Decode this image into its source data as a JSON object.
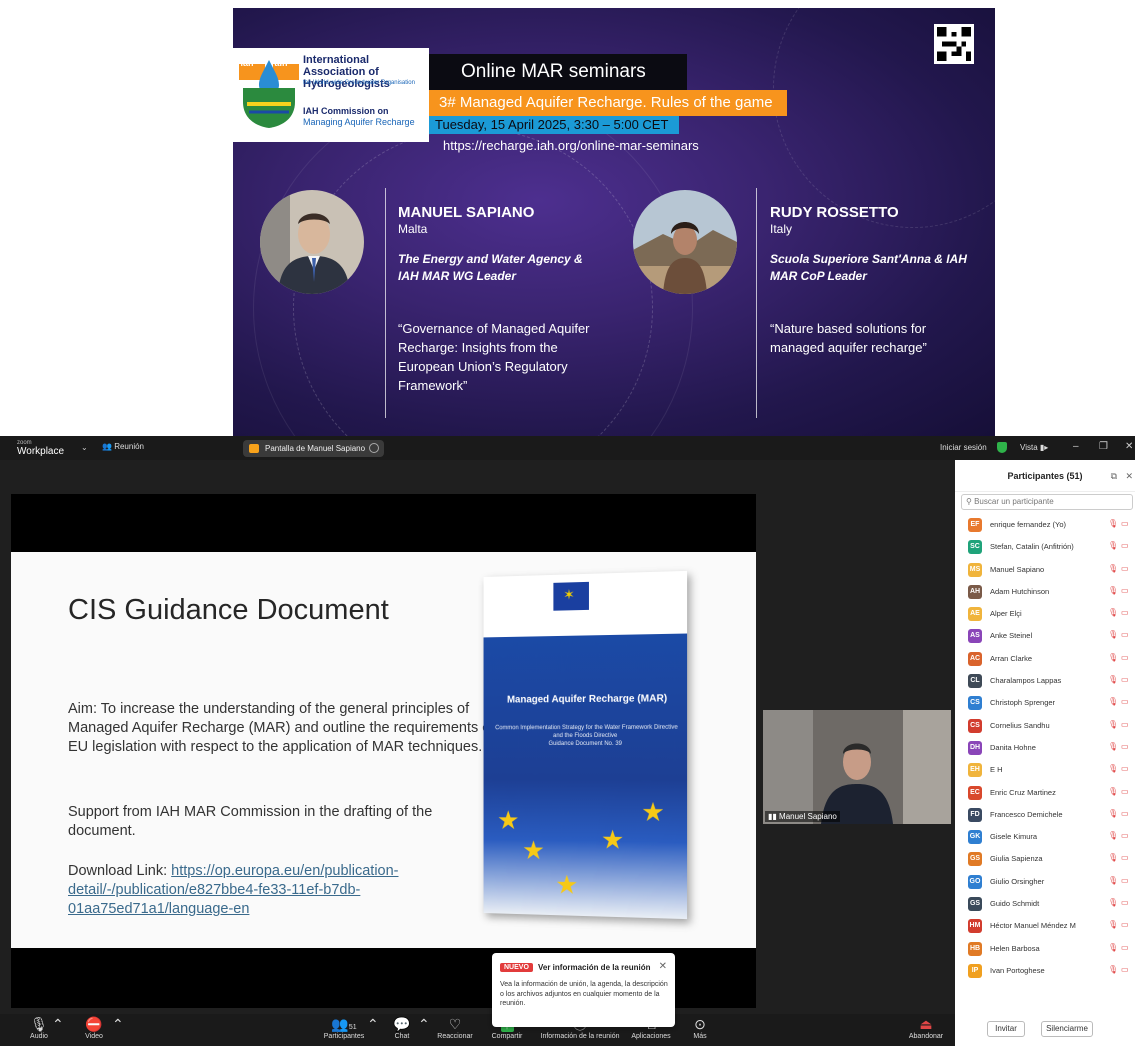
{
  "banner": {
    "org_name": "International Association of Hydrogeologists",
    "org_sub": "the World-wide Groundwater Organisation",
    "commission_line1": "IAH Commission on",
    "commission_line2": "Managing Aquifer Recharge",
    "logo_iah_left": "iah",
    "logo_iah_right": "aih",
    "series": "Online MAR seminars",
    "seminar_title": "3# Managed Aquifer Recharge. Rules of the game",
    "date": "Tuesday, 15 April 2025, 3:30 – 5:00  CET",
    "url": "https://recharge.iah.org/online-mar-seminars",
    "speakers": [
      {
        "name": "MANUEL SAPIANO",
        "country": "Malta",
        "affiliation": "The Energy and Water Agency & IAH MAR WG Leader",
        "talk": "“Governance of Managed Aquifer Recharge: Insights from the European Union’s Regulatory Framework”"
      },
      {
        "name": "RUDY ROSSETTO",
        "country": "Italy",
        "affiliation": "Scuola Superiore Sant'Anna & IAH MAR CoP Leader",
        "talk": "“Nature based solutions for managed aquifer recharge”"
      }
    ]
  },
  "titlebar": {
    "brand_small": "zoom",
    "brand_big": "Workplace",
    "meeting_label": "Reunión",
    "screen_label": "Pantalla de Manuel Sapiano",
    "login": "Iniciar sesión",
    "view": "Vista",
    "minimize": "–",
    "restore": "❐",
    "close": "✕"
  },
  "slide": {
    "title": "CIS Guidance Document",
    "aim": "Aim: To increase the understanding of the general principles of Managed Aquifer Recharge (MAR) and outline the requirements of EU legislation with respect to the application of MAR techniques.",
    "support": "Support from IAH MAR Commission in the drafting of the document.",
    "download_label": "Download Link: ",
    "download_link": "https://op.europa.eu/en/publication-detail/-/publication/e827bbe4-fe33-11ef-b7db-01aa75ed71a1/language-en",
    "book_title": "Managed Aquifer Recharge (MAR)",
    "book_sub": "Common Implementation Strategy for the Water Framework Directive and the Floods Directive",
    "book_doc": "Guidance Document No. 39"
  },
  "camera": {
    "label": "Manuel Sapiano"
  },
  "panel": {
    "title": "Participantes (51)",
    "search_placeholder": "Buscar un participante",
    "participants": [
      {
        "initials": "EF",
        "name": "enrique fernandez (Yo)",
        "color": "#e8792e"
      },
      {
        "initials": "SC",
        "name": "Stefan, Catalin (Anfitrión)",
        "color": "#1fa37a"
      },
      {
        "initials": "MS",
        "name": "Manuel Sapiano",
        "color": "#f0b43c"
      },
      {
        "initials": "AH",
        "name": "Adam Hutchinson",
        "color": "#7a5a48"
      },
      {
        "initials": "AE",
        "name": "Alper Elçi",
        "color": "#f0b43c"
      },
      {
        "initials": "AS",
        "name": "Anke Steinel",
        "color": "#8a45b8"
      },
      {
        "initials": "AC",
        "name": "Arran Clarke",
        "color": "#d9632c"
      },
      {
        "initials": "CL",
        "name": "Charalampos Lappas",
        "color": "#3f4a57"
      },
      {
        "initials": "CS",
        "name": "Christoph Sprenger",
        "color": "#2f7fd1"
      },
      {
        "initials": "CS",
        "name": "Cornelius Sandhu",
        "color": "#d23c2e"
      },
      {
        "initials": "DH",
        "name": "Danita Hohne",
        "color": "#8a45b8"
      },
      {
        "initials": "EH",
        "name": "E H",
        "color": "#f0b43c"
      },
      {
        "initials": "EC",
        "name": "Enric Cruz Martinez",
        "color": "#d9482c"
      },
      {
        "initials": "FD",
        "name": "Francesco Demichele",
        "color": "#3a4a62"
      },
      {
        "initials": "GK",
        "name": "Gisele Kimura",
        "color": "#2f7fd1"
      },
      {
        "initials": "GS",
        "name": "Giulia Sapienza",
        "color": "#e07a25"
      },
      {
        "initials": "GO",
        "name": "Giulio Orsingher",
        "color": "#2f7fd1"
      },
      {
        "initials": "GS",
        "name": "Guido Schmidt",
        "color": "#3a4a5a"
      },
      {
        "initials": "HM",
        "name": "Héctor Manuel Méndez M",
        "color": "#d23c2e"
      },
      {
        "initials": "HB",
        "name": "Helen Barbosa",
        "color": "#e07a25"
      },
      {
        "initials": "IP",
        "name": "Ivan Portoghese",
        "color": "#f0a020"
      }
    ],
    "invite": "Invitar",
    "mute_all": "Silenciarme"
  },
  "toolbar": {
    "audio": "Audio",
    "video": "Video",
    "participants": "Participantes",
    "participants_count": "51",
    "chat": "Chat",
    "react": "Reaccionar",
    "share": "Compartir",
    "info": "Información de la reunión",
    "apps": "Aplicaciones",
    "more": "Más",
    "leave": "Abandonar"
  },
  "popup": {
    "badge": "NUEVO",
    "title": "Ver información de la reunión",
    "body": "Vea la información de unión, la agenda, la descripción o los archivos adjuntos en cualquier momento de la reunión.",
    "close": "✕"
  }
}
